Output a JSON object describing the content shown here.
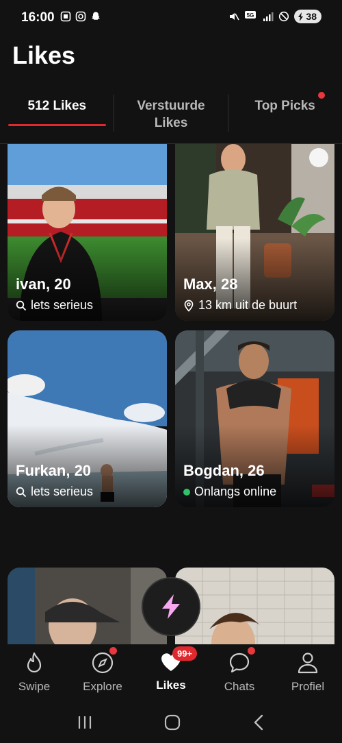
{
  "status_bar": {
    "time": "16:00",
    "network": "5G",
    "battery": "38"
  },
  "page": {
    "title": "Likes"
  },
  "tabs": [
    {
      "label": "512 Likes",
      "active": true
    },
    {
      "label": "Verstuurde Likes",
      "active": false
    },
    {
      "label": "Top Picks",
      "active": false,
      "has_dot": true
    }
  ],
  "cards": [
    {
      "name": "ivan, 20",
      "sub_icon": "search-icon",
      "sub": "lets serieus"
    },
    {
      "name": "Max, 28",
      "sub_icon": "location-pin-icon",
      "sub": "13 km uit de buurt"
    },
    {
      "name": "Furkan, 20",
      "sub_icon": "search-icon",
      "sub": "lets serieus"
    },
    {
      "name": "Bogdan, 26",
      "sub_icon": "online-dot",
      "sub": "Onlangs online"
    },
    {
      "name": "",
      "sub": ""
    },
    {
      "name": "",
      "sub": ""
    }
  ],
  "bottom_nav": [
    {
      "label": "Swipe",
      "icon": "flame-icon"
    },
    {
      "label": "Explore",
      "icon": "compass-icon",
      "has_dot": true
    },
    {
      "label": "Likes",
      "icon": "heart-icon",
      "active": true,
      "badge": "99+"
    },
    {
      "label": "Chats",
      "icon": "chat-bubble-icon",
      "has_dot": true
    },
    {
      "label": "Profiel",
      "icon": "person-icon"
    }
  ],
  "colors": {
    "accent": "#e0292f",
    "background": "#121212",
    "online": "#2fc26b",
    "bolt": "#f7a8f0"
  }
}
